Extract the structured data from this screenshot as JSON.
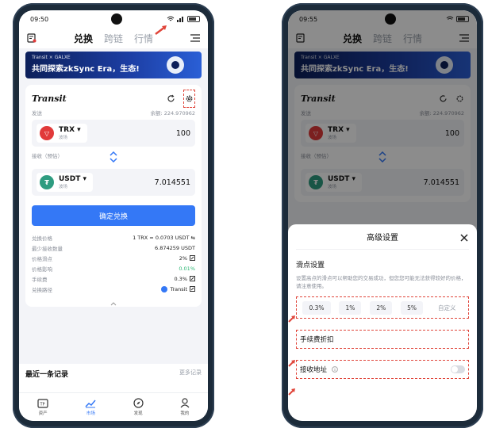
{
  "left": {
    "status": {
      "time": "09:50"
    },
    "nav": {
      "tabs": [
        "兑换",
        "跨链",
        "行情"
      ]
    },
    "banner": {
      "line1": "Transit × GALXE",
      "line2": "共同探索zkSync Era，生态!"
    },
    "card": {
      "brand": "Transit",
      "send_label": "发送",
      "balance": "余额: 224.970962",
      "from_token": {
        "name": "TRX",
        "sub": "波场"
      },
      "from_amount": "100",
      "receive_label": "接收（预估）",
      "to_token": {
        "name": "USDT",
        "sub": "波场"
      },
      "to_amount": "7.014551",
      "confirm_label": "确定兑换",
      "details": [
        {
          "label": "兑换价格",
          "value": "1 TRX = 0.0703 USDT ⇆"
        },
        {
          "label": "最少接收数量",
          "value": "6.874259 USDT"
        },
        {
          "label": "价格滑点",
          "value": "2%"
        },
        {
          "label": "价格影响",
          "value": "0.01%"
        },
        {
          "label": "手续费",
          "value": "0.3%"
        },
        {
          "label": "兑换路径",
          "value": "Transit"
        }
      ]
    },
    "recent": {
      "title": "最近一条记录",
      "more": "更多记录"
    },
    "bottom": [
      "资产",
      "市场",
      "发现",
      "我的"
    ]
  },
  "right": {
    "status": {
      "time": "09:55"
    },
    "nav": {
      "tabs": [
        "兑换",
        "跨链",
        "行情"
      ]
    },
    "banner": {
      "line1": "Transit × GALXE",
      "line2": "共同探索zkSync Era，生态!"
    },
    "card": {
      "brand": "Transit",
      "send_label": "发送",
      "balance": "余额: 224.970962",
      "from_token": {
        "name": "TRX",
        "sub": "波场"
      },
      "from_amount": "100",
      "receive_label": "接收（预估）",
      "to_token": {
        "name": "USDT",
        "sub": "波场"
      },
      "to_amount": "7.014551"
    },
    "sheet": {
      "title": "高级设置",
      "slip_title": "滑点设置",
      "slip_desc": "设置高点的滑点可以帮助您的交易成功，但您您可能无法获得较好的价格，请注意使用。",
      "slip_options": [
        "0.3%",
        "1%",
        "2%",
        "5%",
        "自定义"
      ],
      "fee_label": "手续费折扣",
      "addr_label": "接收地址"
    }
  },
  "colors": {
    "accent": "#3478f6",
    "highlight": "#e0453a",
    "trx": "#e13a3a",
    "usdt": "#2e9c80"
  }
}
